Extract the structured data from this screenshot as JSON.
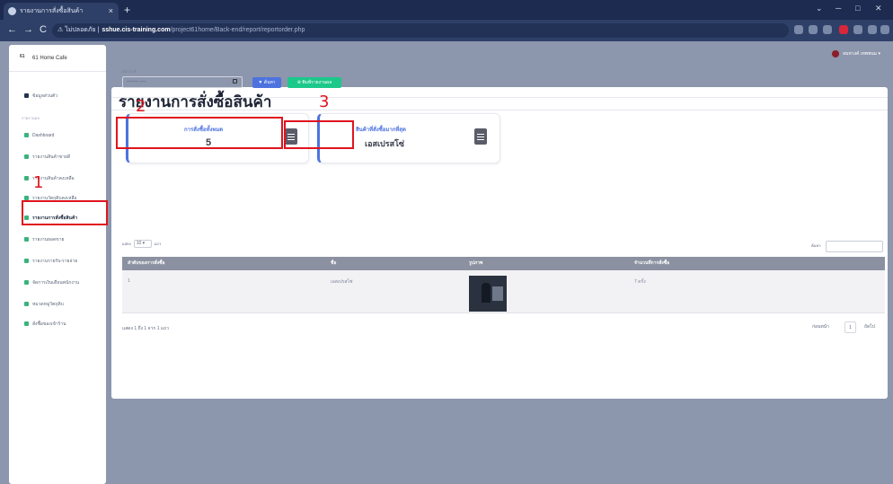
{
  "browser": {
    "tab_title": "รายงานการสั่งซื้อสินค้า",
    "tab_close": "×",
    "new_tab": "+",
    "security": "⚠ ไม่ปลอดภัย |",
    "host": "sshue.cis-training.com",
    "path": "/project61home/Back-end/report/reportorder.php",
    "back": "←",
    "forward": "→",
    "reload": "C",
    "minimize": "─",
    "maximize": "□",
    "close": "✕",
    "chevron": "⌄"
  },
  "sidebar": {
    "logo": "61",
    "brand": "61 Home Cafe",
    "top_item": "ข้อมูลส่วนตัว",
    "heading": "รายงานผล",
    "items": [
      {
        "label": "Dashboard"
      },
      {
        "label": "รายงานสินค้าขายดี"
      },
      {
        "label": "รายงานสินค้าคงเหลือ"
      },
      {
        "label": "รายงานวัตถุดิบคงเหลือ"
      },
      {
        "label": "รายงานการสั่งซื้อสินค้า"
      },
      {
        "label": "รายงานยอดขาย"
      },
      {
        "label": "รายงานรายรับ-รายจ่าย"
      },
      {
        "label": "จัดการเงินเดือนพนักงาน"
      },
      {
        "label": "หมวดหมู่วัตถุดิบ"
      },
      {
        "label": "สั่งซื้อของเข้าร้าน"
      }
    ]
  },
  "topbar": {
    "user": "สมหวงค์ เทพพนม ▾"
  },
  "main": {
    "title": "รายงานการสั่งซื้อสินค้า",
    "filter_label": "เลือกวันที่",
    "date_placeholder": "-------- ----",
    "filter_btn": "▼ ค้นหา",
    "print_btn": "⊕ พิมพ์รายงานผล",
    "stat_total_label": "การสั่งซื้อทั้งหมด",
    "stat_total_value": "5",
    "stat_top_label": "สินค้าที่สั่งซื้อมากที่สุด",
    "stat_top_value": "เอสเปรสโซ่",
    "show_prefix": "แสดง",
    "show_value": "10 ▾",
    "show_suffix": "แถว",
    "search_label": "ค้นหา:",
    "columns": [
      "ลำดับของการสั่งซื้อ",
      "ชื่อ",
      "รูปภาพ",
      "จำนวนที่การสั่งซื้อ"
    ],
    "rows": [
      {
        "no": "1",
        "name": "เอสเปรสโซ่",
        "qty": "7 ครั้ง"
      }
    ],
    "info": "แสดง 1 ถึง 1 จาก 1 แถว",
    "prev": "ก่อนหน้า",
    "page": "1",
    "next": "ถัดไป"
  },
  "annotations": {
    "n1": "1",
    "n2": "2",
    "n3": "3"
  },
  "colors": {
    "highlight": "#e0141e",
    "primary": "#4e73df",
    "success": "#1cc88a"
  }
}
